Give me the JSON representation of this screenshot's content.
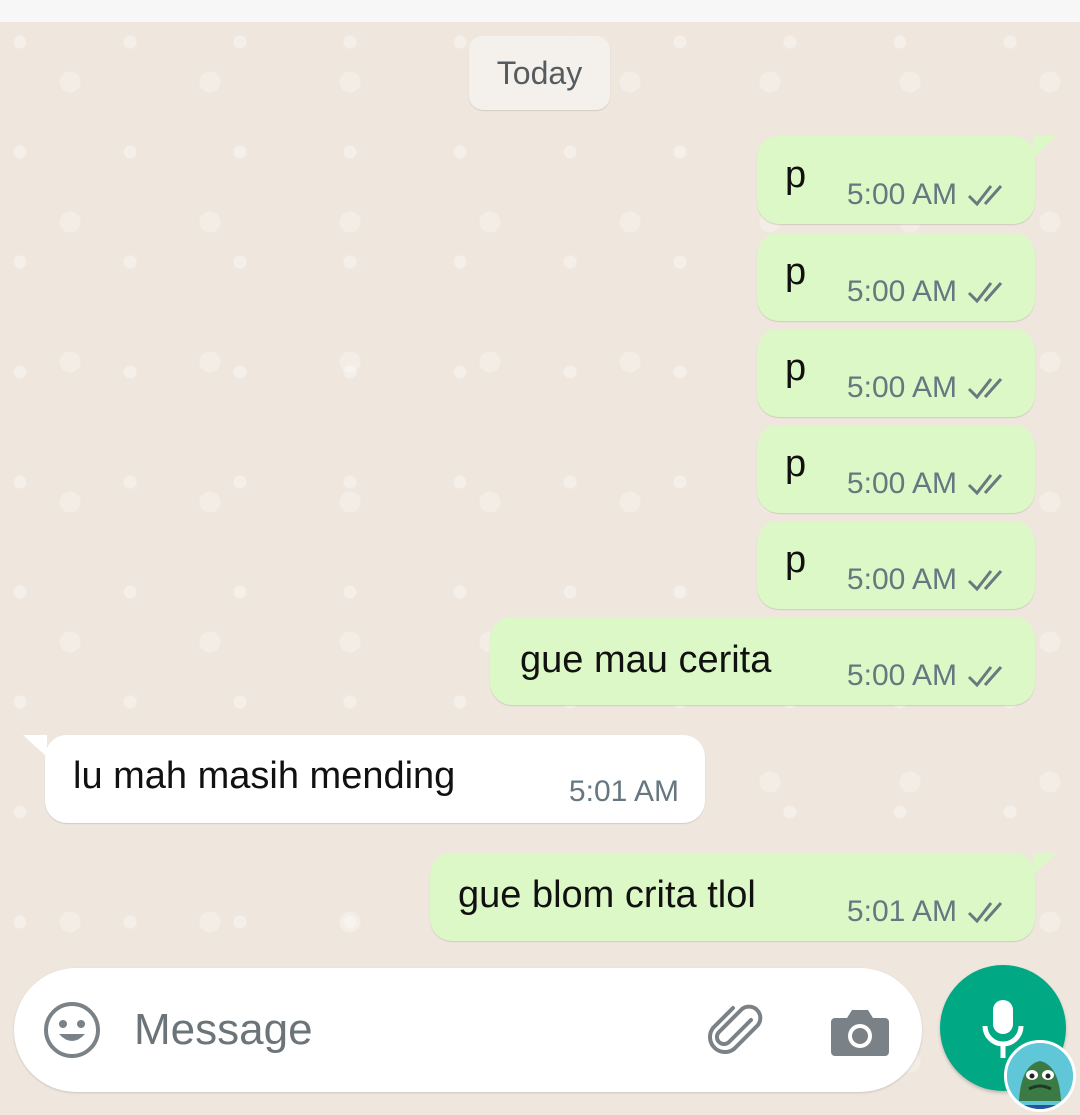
{
  "date_chip": "Today",
  "messages": [
    {
      "dir": "out",
      "text": "p",
      "time": "5:00 AM",
      "status": "read"
    },
    {
      "dir": "out",
      "text": "p",
      "time": "5:00 AM",
      "status": "read"
    },
    {
      "dir": "out",
      "text": "p",
      "time": "5:00 AM",
      "status": "read"
    },
    {
      "dir": "out",
      "text": "p",
      "time": "5:00 AM",
      "status": "read"
    },
    {
      "dir": "out",
      "text": "p",
      "time": "5:00 AM",
      "status": "read"
    },
    {
      "dir": "out",
      "text": "gue mau cerita",
      "time": "5:00 AM",
      "status": "read"
    },
    {
      "dir": "in",
      "text": "lu mah masih mending",
      "time": "5:01 AM"
    },
    {
      "dir": "out",
      "text": "gue blom crita tlol",
      "time": "5:01 AM",
      "status": "read"
    }
  ],
  "composer": {
    "placeholder": "Message",
    "icons": [
      "emoji-icon",
      "paperclip-icon",
      "camera-icon",
      "microphone-icon"
    ]
  },
  "colors": {
    "outgoing": "#dcf8c6",
    "incoming": "#ffffff",
    "accent": "#00a884"
  }
}
